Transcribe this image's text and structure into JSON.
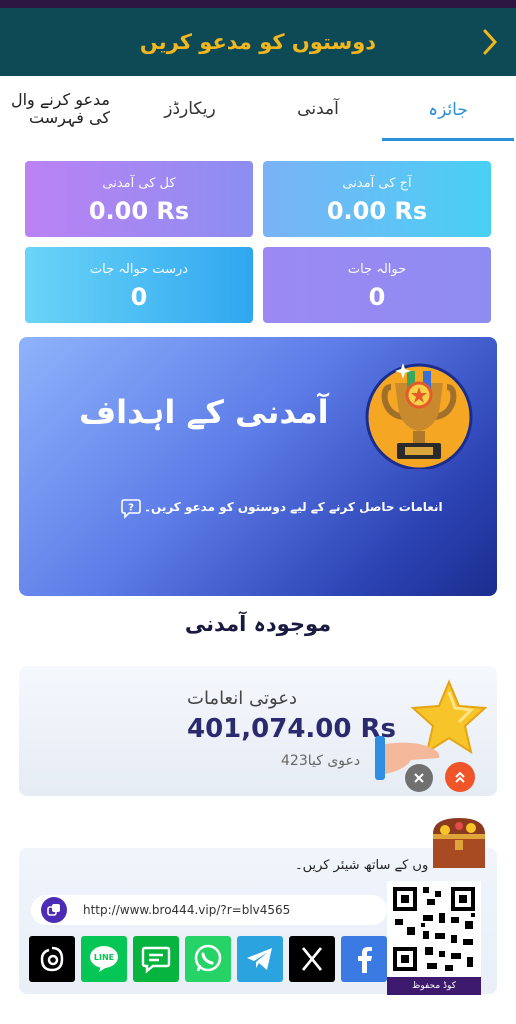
{
  "header": {
    "title": "دوستوں کو مدعو کریں",
    "back_icon": "chevron-right-icon"
  },
  "tabs": [
    {
      "label": "جائزہ",
      "active": true
    },
    {
      "label": "آمدنی",
      "active": false
    },
    {
      "label": "ریکارڈز",
      "active": false
    },
    {
      "label_line1": "مدعو کرنے وال",
      "label_line2": "کی فہرست",
      "active": false
    }
  ],
  "stats": [
    {
      "label": "آج کی آمدنی",
      "value": "0.00 Rs"
    },
    {
      "label": "کل کی آمدنی",
      "value": "0.00 Rs"
    },
    {
      "label": "حوالہ جات",
      "value": "0"
    },
    {
      "label": "درست حوالہ جات",
      "value": "0"
    }
  ],
  "goals": {
    "title": "آمدنی کے اہداف",
    "subtitle": "انعامات حاصل کرنے کے لیے دوستوں کو مدعو کریں۔"
  },
  "current_earnings": {
    "section_title": "موجودہ آمدنی",
    "label": "دعوتی انعامات",
    "amount": "401,074.00 Rs",
    "invited_count": "423",
    "invited_label": "دعوی کیا"
  },
  "share": {
    "title": "وں کے ساتھ شیئر کریں۔",
    "link": "http://www.bro444.vip/?r=blv4565",
    "qr_caption": "کوڈ محفوظ",
    "socials": [
      {
        "name": "threads-icon",
        "color": "#000000"
      },
      {
        "name": "line-icon",
        "color": "#06c755"
      },
      {
        "name": "message-icon",
        "color": "#06b43f"
      },
      {
        "name": "whatsapp-icon",
        "color": "#25d366"
      },
      {
        "name": "telegram-icon",
        "color": "#2aa3df"
      },
      {
        "name": "x-icon",
        "color": "#000000"
      },
      {
        "name": "facebook-icon",
        "color": "#3b79e3"
      }
    ]
  },
  "colors": {
    "header_bg": "#0e4a55",
    "header_title": "#f2b61e",
    "active_tab": "#2d8fd9"
  }
}
